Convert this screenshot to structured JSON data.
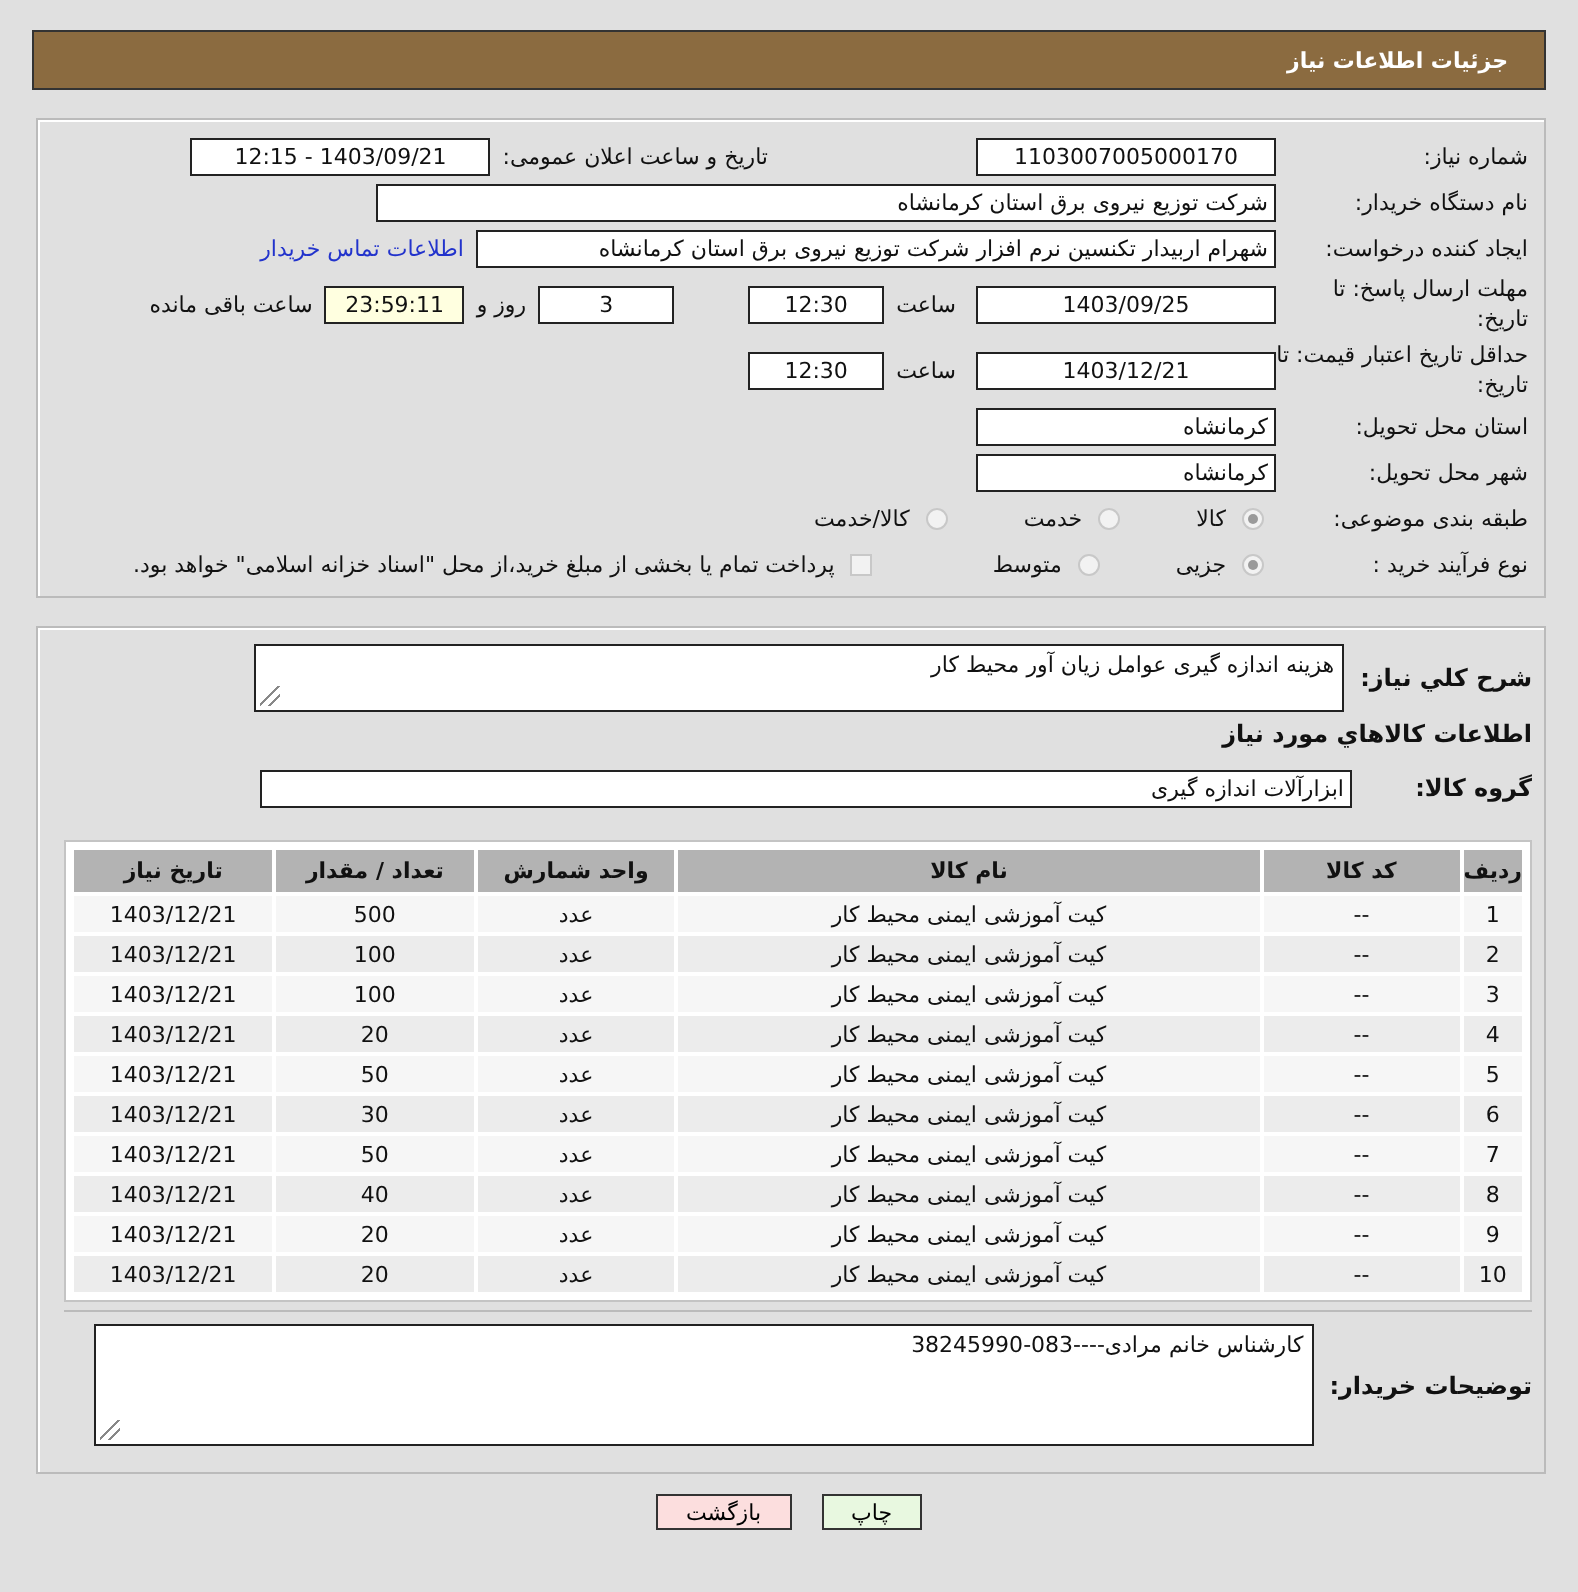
{
  "header": {
    "title": "جزئیات اطلاعات نیاز"
  },
  "need_number": {
    "label": "شماره نیاز:",
    "value": "1103007005000170"
  },
  "announce": {
    "label": "تاریخ و ساعت اعلان عمومی:",
    "value": "1403/09/21 - 12:15"
  },
  "buyer_org": {
    "label": "نام دستگاه خریدار:",
    "value": "شرکت توزیع نیروی برق استان کرمانشاه"
  },
  "requester": {
    "label": "ایجاد کننده درخواست:",
    "value": "شهرام اربیدار تکنسین نرم افزار شرکت توزیع نیروی برق استان کرمانشاه",
    "link": "اطلاعات تماس خریدار"
  },
  "deadline": {
    "label": "مهلت ارسال پاسخ: تا تاریخ:",
    "date": "1403/09/25",
    "time_label": "ساعت",
    "time": "12:30",
    "days": "3",
    "days_label": "روز و",
    "remaining": "23:59:11",
    "remaining_label": "ساعت باقی مانده"
  },
  "validity": {
    "label": "حداقل تاریخ اعتبار قیمت: تا تاریخ:",
    "date": "1403/12/21",
    "time_label": "ساعت",
    "time": "12:30"
  },
  "province": {
    "label": "استان محل تحویل:",
    "value": "کرمانشاه"
  },
  "city": {
    "label": "شهر محل تحویل:",
    "value": "کرمانشاه"
  },
  "category": {
    "label": "طبقه بندی موضوعی:",
    "options": [
      {
        "label": "کالا",
        "selected": true
      },
      {
        "label": "خدمت",
        "selected": false
      },
      {
        "label": "کالا/خدمت",
        "selected": false
      }
    ]
  },
  "purchase_type": {
    "label": "نوع فرآیند خرید :",
    "options": [
      {
        "label": "جزیی",
        "selected": true
      },
      {
        "label": "متوسط",
        "selected": false
      }
    ],
    "partial_payment": {
      "checked": false,
      "label": "پرداخت تمام یا بخشی از مبلغ خرید،از محل \"اسناد خزانه اسلامی\" خواهد بود."
    }
  },
  "description": {
    "label": "شرح کلي نياز:",
    "value": "هزینه اندازه گیری عوامل زیان آور محیط کار"
  },
  "goods_heading": "اطلاعات کالاهاي مورد نياز",
  "goods_group": {
    "label": "گروه کالا:",
    "value": "ابزارآلات اندازه گیری"
  },
  "table": {
    "columns": [
      "ردیف",
      "کد کالا",
      "نام کالا",
      "واحد شمارش",
      "تعداد / مقدار",
      "تاریخ نیاز"
    ],
    "rows": [
      [
        "1",
        "--",
        "کیت آموزشی ایمنی محیط کار",
        "عدد",
        "500",
        "1403/12/21"
      ],
      [
        "2",
        "--",
        "کیت آموزشی ایمنی محیط کار",
        "عدد",
        "100",
        "1403/12/21"
      ],
      [
        "3",
        "--",
        "کیت آموزشی ایمنی محیط کار",
        "عدد",
        "100",
        "1403/12/21"
      ],
      [
        "4",
        "--",
        "کیت آموزشی ایمنی محیط کار",
        "عدد",
        "20",
        "1403/12/21"
      ],
      [
        "5",
        "--",
        "کیت آموزشی ایمنی محیط کار",
        "عدد",
        "50",
        "1403/12/21"
      ],
      [
        "6",
        "--",
        "کیت آموزشی ایمنی محیط کار",
        "عدد",
        "30",
        "1403/12/21"
      ],
      [
        "7",
        "--",
        "کیت آموزشی ایمنی محیط کار",
        "عدد",
        "50",
        "1403/12/21"
      ],
      [
        "8",
        "--",
        "کیت آموزشی ایمنی محیط کار",
        "عدد",
        "40",
        "1403/12/21"
      ],
      [
        "9",
        "--",
        "کیت آموزشی ایمنی محیط کار",
        "عدد",
        "20",
        "1403/12/21"
      ],
      [
        "10",
        "--",
        "کیت آموزشی ایمنی محیط کار",
        "عدد",
        "20",
        "1403/12/21"
      ]
    ]
  },
  "buyer_notes": {
    "label": "توضیحات خریدار:",
    "value": "کارشناس خانم مرادی----083-38245990"
  },
  "buttons": [
    {
      "label": "چاپ",
      "kind": "print"
    },
    {
      "label": "بازگشت",
      "kind": "back"
    }
  ]
}
